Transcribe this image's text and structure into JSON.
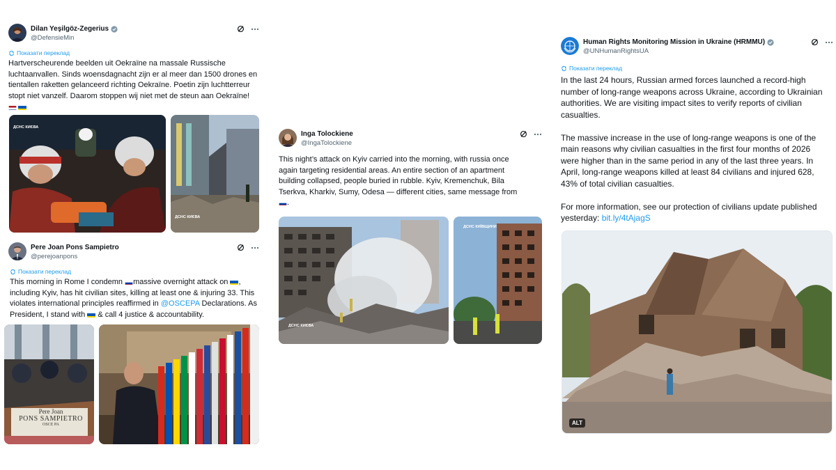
{
  "colors": {
    "accent": "#1d9bf0",
    "muted": "#536471",
    "text": "#0f1419"
  },
  "translate_label": "Показати переклад",
  "tweets": [
    {
      "author": "Dilan Yeşilgöz-Zegerius",
      "handle": "@DefensieMin",
      "verified": true,
      "text_lines": [
        "Hartverscheurende beelden uit Oekraïne na massale Russische",
        "luchtaanvallen. Sinds woensdagnacht zijn er al meer dan 1500 drones en",
        "tientallen raketten gelanceerd richting Oekraïne. Poetin zijn luchtterreur",
        "stopt niet vanzelf. Daarom stoppen wij niet met de steun aan Oekraïne!"
      ],
      "flags": [
        "nl-flag",
        "ua-flag"
      ],
      "image_watermark": "ДСНС КИЄВА"
    },
    {
      "author": "Pere Joan Pons Sampietro",
      "handle": "@perejoanpons",
      "verified": false,
      "line1_a": "This morning in Rome I condemn ",
      "line1_b": "massive overnight attack on ",
      "line1_c": ",",
      "line2": "including Kyiv, has hit civilian sites, killing at least one & injuring 33. This",
      "line3_a": "violates international principles reaffirmed in ",
      "line3_link": "@OSCEPA",
      "line3_b": " Declarations. As",
      "line4_a": "President, I stand with ",
      "line4_b": " & call 4 justice & accountability.",
      "nameplate_line1": "Pere Joan",
      "nameplate_line2": "PONS SAMPIETRO",
      "nameplate_line3": "OSCE PA"
    },
    {
      "author": "Inga Tolockiene",
      "handle": "@IngaTolockiene",
      "verified": false,
      "text_lines": [
        "This night’s attack on Kyiv carried into the morning, with russia once",
        "again targeting residential areas. An entire section of an apartment",
        "building collapsed, people buried in rubble. Kyiv, Kremenchuk, Bila",
        "Tserkva, Kharkiv, Sumy, Odesa — different cities, same message from"
      ],
      "end_char": ".",
      "watermark_1": "ДСНС КИЄВА",
      "watermark_2": "ДСНС КИЇВЩИНИ"
    },
    {
      "author": "Human Rights Monitoring Mission in Ukraine (HRMMU)",
      "handle": "@UNHumanRightsUA",
      "verified": true,
      "para1": [
        "In the last 24 hours, Russian armed forces launched a record-high",
        "number of long-range weapons across Ukraine, according to Ukrainian",
        "authorities. We are visiting impact sites to verify reports of civilian",
        "casualties."
      ],
      "para2": [
        "The massive increase in the use of long-range weapons is one of the",
        "main reasons why civilian casualties in the first four months of 2026",
        "were higher than in the same period in any of the last three years. In",
        "April, long-range weapons killed at least 84 civilians and injured 628,",
        "43% of total civilian casualties."
      ],
      "para3_line1": "For more information, see our protection of civilians update published",
      "para3_line2_a": "yesterday: ",
      "para3_link": "bit.ly/4tAjagS",
      "alt_badge": "ALT"
    }
  ]
}
